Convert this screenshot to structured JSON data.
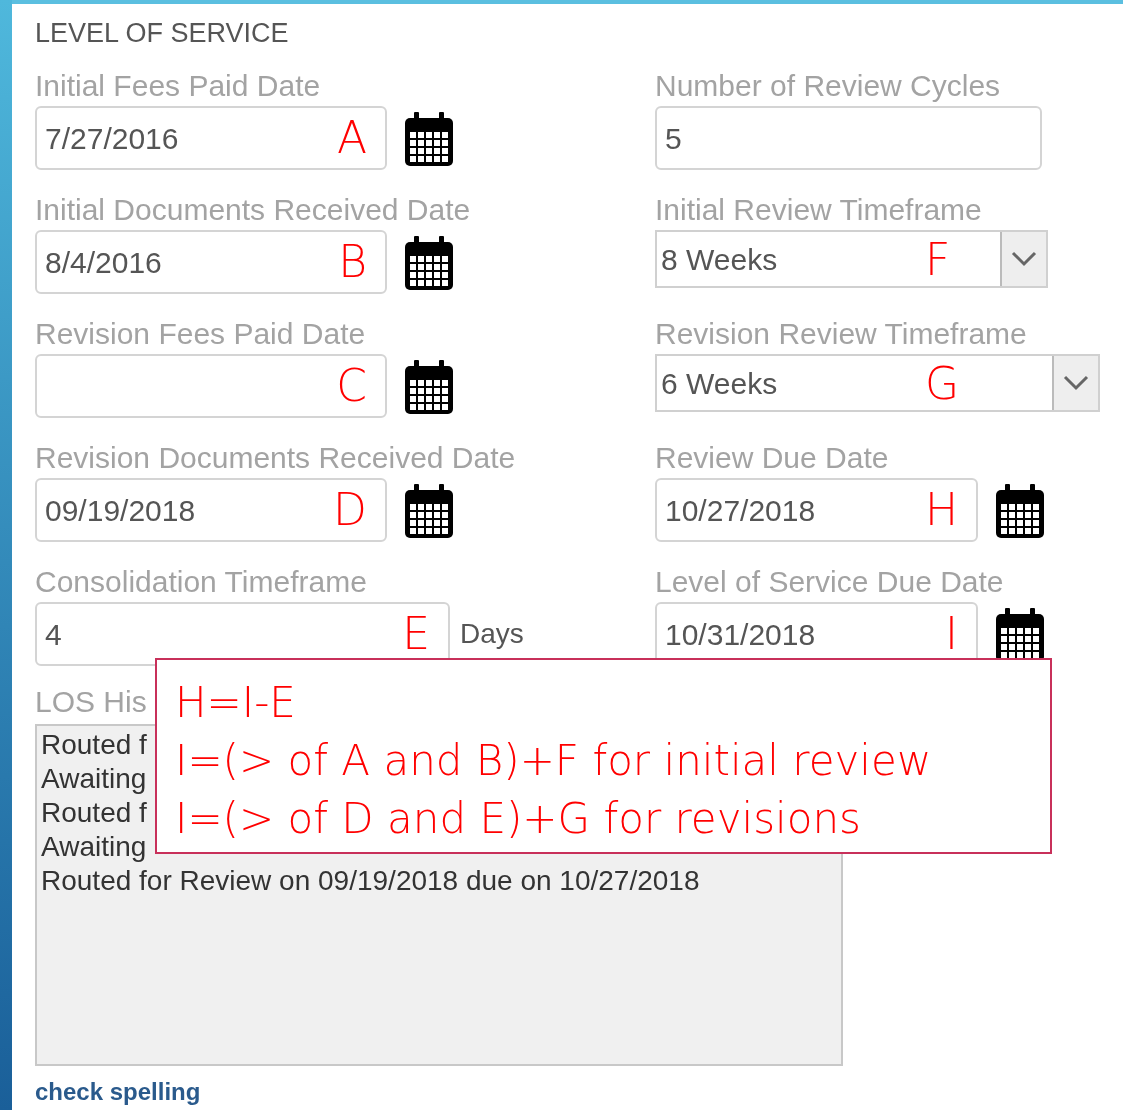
{
  "section_title": "LEVEL OF SERVICE",
  "left_fields": [
    {
      "kind": "date",
      "label": "Initial Fees Paid Date",
      "value": "7/27/2016",
      "marker": "A"
    },
    {
      "kind": "date",
      "label": "Initial Documents Received Date",
      "value": "8/4/2016",
      "marker": "B"
    },
    {
      "kind": "date",
      "label": "Revision Fees Paid Date",
      "marker": "C"
    },
    {
      "kind": "date",
      "label": "Revision Documents Received Date",
      "value": "09/19/2018",
      "marker": "D"
    },
    {
      "kind": "unit",
      "label": "Consolidation Timeframe",
      "value": "4",
      "unit": "Days",
      "marker": "E"
    }
  ],
  "right_fields": [
    {
      "kind": "number",
      "label": "Number of Review Cycles",
      "value": "5"
    },
    {
      "kind": "select",
      "label": "Initial Review Timeframe",
      "value": "8 Weeks",
      "marker": "F"
    },
    {
      "kind": "select_wide",
      "label": "Revision Review Timeframe",
      "value": "6 Weeks",
      "marker": "G"
    },
    {
      "kind": "date",
      "label": "Review Due Date",
      "value": "10/27/2018",
      "marker": "H"
    },
    {
      "kind": "date",
      "label": "Level of Service Due Date",
      "value": "10/31/2018",
      "marker": "I"
    }
  ],
  "history": {
    "label": "LOS His",
    "lines": [
      "Routed f",
      "Awaiting",
      "Routed f",
      "Awaiting",
      "Routed for Review on 09/19/2018 due on 10/27/2018"
    ]
  },
  "check_spelling": "check spelling",
  "annotation": {
    "lines": [
      "H=I-E",
      "I=(> of A and B)+F for initial review",
      "I=(> of D and E)+G for revisions"
    ]
  }
}
